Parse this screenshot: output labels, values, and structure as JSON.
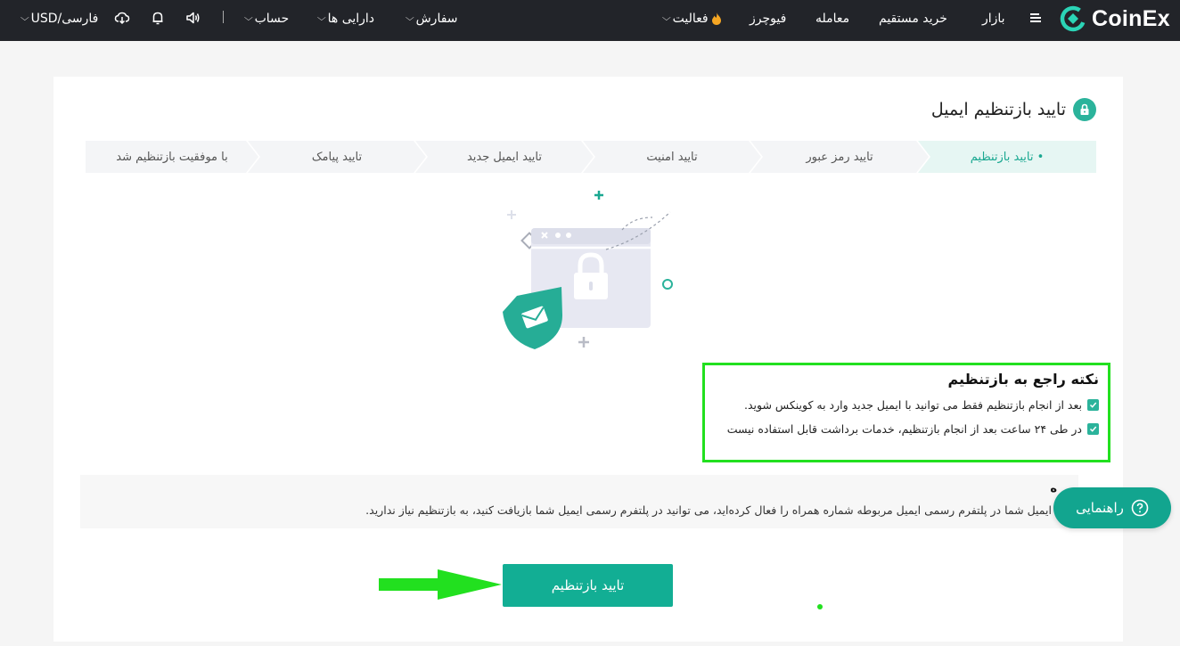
{
  "brand": {
    "name": "CoinEx",
    "accent": "#12ae94",
    "nav_bg": "#222429",
    "highlight": "#22e01f"
  },
  "nav": {
    "items": [
      {
        "label": "بازار",
        "dropdown": false
      },
      {
        "label": "خرید مستقیم",
        "dropdown": false
      },
      {
        "label": "معامله",
        "dropdown": false
      },
      {
        "label": "فیوچرز",
        "dropdown": false
      },
      {
        "label": "فعالیت",
        "dropdown": true,
        "icon": "fire-icon"
      },
      {
        "label": "سفارش",
        "dropdown": true
      },
      {
        "label": "دارایی ها",
        "dropdown": true
      },
      {
        "label": "حساب",
        "dropdown": true
      }
    ],
    "language": "فارسی/USD",
    "icons": [
      "menu-icon",
      "speaker-icon",
      "bell-icon",
      "download-icon"
    ]
  },
  "page": {
    "title": "تایید بازتنظیم ایمیل",
    "title_icon": "lock-icon"
  },
  "steps": [
    {
      "label": "• تایید بازتنظیم",
      "active": true
    },
    {
      "label": "تایید رمز عبور",
      "active": false
    },
    {
      "label": "تایید امنیت",
      "active": false
    },
    {
      "label": "تایید ایمیل جدید",
      "active": false
    },
    {
      "label": "تایید پیامک",
      "active": false
    },
    {
      "label": "با موفقیت بازتنظیم شد",
      "active": false
    }
  ],
  "notice": {
    "title": "نکته راجع به بازتنظیم",
    "items": [
      "بعد از انجام بازتنظیم فقط می توانید با ایمیل جدید وارد به کوینکس شوید.",
      "در طی ۲۴ ساعت بعد از انجام بازتنظیم، خدمات برداشت قابل استفاده نیست"
    ]
  },
  "info": {
    "heading": "ه",
    "text": "ایمیل شما در پلتفرم رسمی ایمیل مربوطه شماره همراه را فعال کرده‌اید، می توانید در پلتفرم رسمی ایمیل شما بازیافت کنید، به بازتنظیم نیاز ندارید."
  },
  "guide": {
    "label": "راهنمایی",
    "icon": "help-circle-icon"
  },
  "confirm": {
    "label": "تایید بازتنظیم"
  }
}
